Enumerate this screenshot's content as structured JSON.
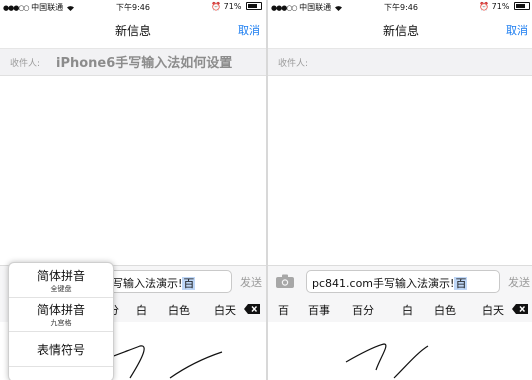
{
  "status": {
    "carrier": "中国联通",
    "time": "下午9:46",
    "battery": "71%"
  },
  "nav": {
    "title": "新信息",
    "cancel": "取消"
  },
  "recipient": {
    "label": "收件人:",
    "left_value": "iPhone6手写输入法如何设置",
    "right_value": ""
  },
  "left_phone": {
    "input_text": "手写输入法演示!",
    "input_cursor_char": "百",
    "send": "发送",
    "candidates": [
      "分",
      "白",
      "白色",
      "白天"
    ],
    "popup": {
      "items": [
        {
          "label": "简体拼音",
          "sub": "全键盘"
        },
        {
          "label": "简体拼音",
          "sub": "九宫格"
        },
        {
          "label": "表情符号"
        }
      ]
    }
  },
  "right_phone": {
    "input_text": "pc841.com手写输入法演示!",
    "input_cursor_char": "百",
    "send": "发送",
    "candidates": [
      "百",
      "百事",
      "百分",
      "白",
      "白色",
      "白天"
    ]
  },
  "colors": {
    "link": "#1a7cf0",
    "placeholder": "#9b9b9b"
  },
  "icons": [
    "signal-dots-icon",
    "wifi-icon",
    "alarm-icon",
    "battery-icon",
    "camera-icon",
    "backspace-icon"
  ]
}
